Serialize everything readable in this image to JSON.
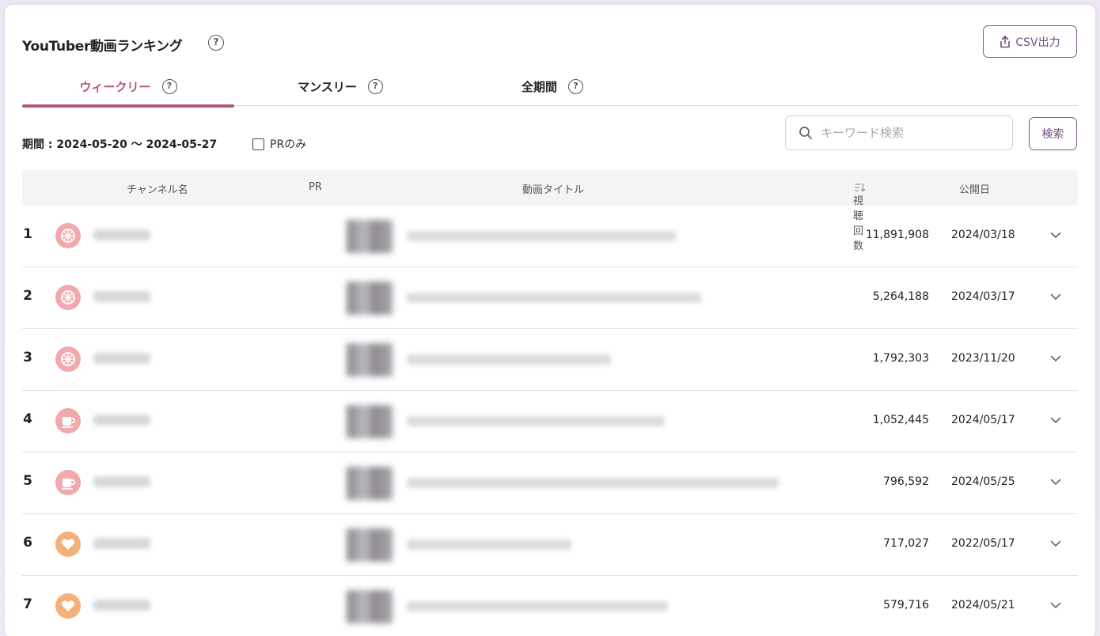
{
  "header": {
    "title": "YouTuber動画ランキング",
    "help": "?",
    "csv_label": "CSV出力"
  },
  "tabs": [
    {
      "label": "ウィークリー",
      "active": true
    },
    {
      "label": "マンスリー",
      "active": false
    },
    {
      "label": "全期間",
      "active": false
    }
  ],
  "filters": {
    "period": "期間 : 2024-05-20 〜 2024-05-27",
    "pr_only_label": "PRのみ",
    "pr_only_checked": false,
    "search_placeholder": "キーワード検索",
    "search_value": "",
    "search_button": "検索"
  },
  "table": {
    "columns": {
      "channel": "チャンネル名",
      "pr": "PR",
      "title": "動画タイトル",
      "views": "視聴回数",
      "published": "公開日"
    },
    "rows": [
      {
        "rank": "1",
        "avatar": "dharma-wheel-icon",
        "avatar_color": "pink",
        "views": "11,891,908",
        "date": "2024/03/18"
      },
      {
        "rank": "2",
        "avatar": "dharma-wheel-icon",
        "avatar_color": "pink",
        "views": "5,264,188",
        "date": "2024/03/17"
      },
      {
        "rank": "3",
        "avatar": "dharma-wheel-icon",
        "avatar_color": "pink",
        "views": "1,792,303",
        "date": "2023/11/20"
      },
      {
        "rank": "4",
        "avatar": "cup-icon",
        "avatar_color": "pink",
        "views": "1,052,445",
        "date": "2024/05/17"
      },
      {
        "rank": "5",
        "avatar": "cup-icon",
        "avatar_color": "pink",
        "views": "796,592",
        "date": "2024/05/25"
      },
      {
        "rank": "6",
        "avatar": "heart-icon",
        "avatar_color": "orange",
        "views": "717,027",
        "date": "2022/05/17"
      },
      {
        "rank": "7",
        "avatar": "heart-icon",
        "avatar_color": "orange",
        "views": "579,716",
        "date": "2024/05/21"
      }
    ]
  },
  "colors": {
    "accent": "#b4566e",
    "button_border": "#7b5a8e",
    "avatar_pink": "#f2a9ad",
    "avatar_orange": "#f4b07a"
  }
}
